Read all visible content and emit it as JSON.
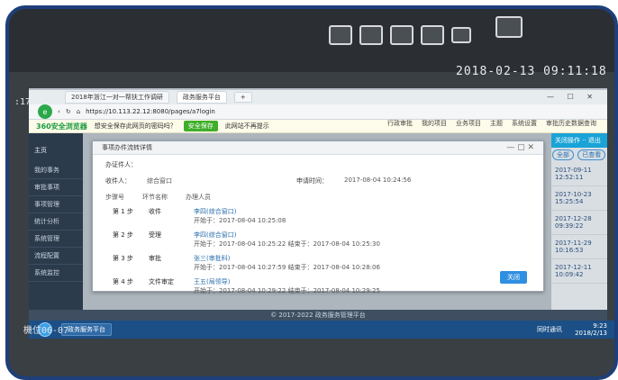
{
  "wall": {
    "datetime": "2018-02-13 09:11:18",
    "left_time": ":17",
    "slot": "機位06-07"
  },
  "browser": {
    "tabs": [
      "2018年浙江一对一帮扶工作调研",
      "政务服务平台",
      "+"
    ],
    "url": "https://10.113.22.12:8080/pages/a7login",
    "brand": "360安全浏览器",
    "notify": "想安全保存此网页的密码吗？",
    "save_btn": "安全保存",
    "never_btn": "此网站不再提示",
    "nav": [
      "行政审批",
      "我的项目",
      "业务项目",
      "主题",
      "系统设置",
      "审批历史数据查询"
    ],
    "window_ctrls": "— ☐ ✕"
  },
  "sidebar": {
    "user": "主页",
    "items": [
      "我的事务",
      "审批事项",
      "事项管理",
      "统计分析",
      "系统管理",
      "流程配置",
      "系统监控"
    ]
  },
  "dialog": {
    "title": "事项办件流转详情",
    "applicant_label": "办证件人：",
    "handler_label": "收件人：",
    "handler_value": "综合窗口",
    "apply_time_label": "申请时间：",
    "apply_time_value": "2017-08-04 10:24:56",
    "flow_headers": [
      "步骤号",
      "环节名称",
      "办理人员"
    ],
    "flows": [
      {
        "step": "第 1 步",
        "name": "收件",
        "handler": "李四(综合窗口)",
        "times": "开始于：2017-08-04 10:25:08"
      },
      {
        "step": "第 2 步",
        "name": "受理",
        "handler": "李四(综合窗口)",
        "times": "开始于：2017-08-04 10:25:22  结束于：2017-08-04 10:25:30"
      },
      {
        "step": "第 3 步",
        "name": "审批",
        "handler": "张三(审批科)",
        "times": "开始于：2017-08-04 10:27:59  结束于：2017-08-04 10:28:06"
      },
      {
        "step": "第 4 步",
        "name": "文件审定",
        "handler": "王五(局领导)",
        "times": "开始于：2017-08-04 10:29:22  结束于：2017-08-04 10:29:25"
      }
    ],
    "ok": "关闭"
  },
  "right_panel": {
    "header": "关闭操作 ·· 退出",
    "pills": [
      "全部",
      "已查看"
    ],
    "dates": [
      "2017-09-11 12:52:11",
      "2017-10-23 15:25:54",
      "2017-12-28 09:39:22",
      "2017-11-29 10:16:53",
      "2017-12-11 10:09:42"
    ]
  },
  "footer": "© 2017-2022 政务服务管理平台",
  "taskbar": {
    "items": [
      "政务服务平台"
    ],
    "time": "9:23",
    "date": "2018/2/13",
    "right_label": "同时通讯"
  }
}
